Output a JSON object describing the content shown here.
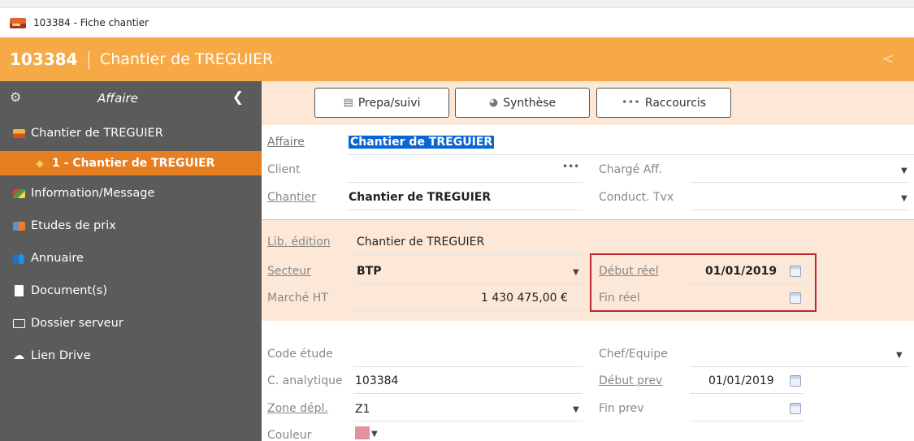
{
  "window": {
    "title": "103384 - Fiche chantier"
  },
  "header": {
    "number": "103384",
    "separator": "|",
    "name": "Chantier de TREGUIER",
    "collapse_glyph": "<"
  },
  "sidebar": {
    "title": "Affaire",
    "items": [
      {
        "label": "Chantier de TREGUIER",
        "icon": "folder-icon"
      },
      {
        "label": "1 - Chantier de TREGUIER",
        "icon": "diamond-icon",
        "active": true
      },
      {
        "label": "Information/Message",
        "icon": "message-icon"
      },
      {
        "label": "Etudes de prix",
        "icon": "price-study-icon"
      },
      {
        "label": "Annuaire",
        "icon": "contacts-icon"
      },
      {
        "label": "Document(s)",
        "icon": "document-icon"
      },
      {
        "label": "Dossier serveur",
        "icon": "server-folder-icon"
      },
      {
        "label": "Lien Drive",
        "icon": "cloud-icon"
      }
    ]
  },
  "toolbar": {
    "prepa_label": "Prepa/suivi",
    "synthese_label": "Synthèse",
    "raccourcis_label": "Raccourcis",
    "raccourcis_glyph": "•••"
  },
  "form": {
    "affaire": {
      "label": "Affaire",
      "value": "Chantier de TREGUIER"
    },
    "client": {
      "label": "Client",
      "value": "",
      "more_glyph": "•••"
    },
    "charge_aff": {
      "label": "Chargé Aff.",
      "value": ""
    },
    "chantier": {
      "label": "Chantier",
      "value": "Chantier de TREGUIER"
    },
    "conduct_tvx": {
      "label": "Conduct. Tvx",
      "value": ""
    },
    "lib_edition": {
      "label": "Lib. édition",
      "value": "Chantier de TREGUIER"
    },
    "secteur": {
      "label": "Secteur",
      "value": "BTP"
    },
    "debut_reel": {
      "label": "Début réel",
      "value": "01/01/2019"
    },
    "marche_ht": {
      "label": "Marché HT",
      "value": "1 430 475,00 €"
    },
    "fin_reel": {
      "label": "Fin réel",
      "value": ""
    },
    "code_etude": {
      "label": "Code étude",
      "value": ""
    },
    "chef_equipe": {
      "label": "Chef/Equipe",
      "value": ""
    },
    "c_analytique": {
      "label": "C. analytique",
      "value": "103384"
    },
    "debut_prev": {
      "label": "Début prev",
      "value": "01/01/2019"
    },
    "zone_depl": {
      "label": "Zone dépl.",
      "value": "Z1"
    },
    "fin_prev": {
      "label": "Fin prev",
      "value": ""
    },
    "couleur": {
      "label": "Couleur",
      "swatch_color": "#e0939a"
    }
  },
  "colors": {
    "accent": "#f6a944",
    "active_item": "#e67e22",
    "sidebar": "#5b5b5b",
    "band": "#fde8d8",
    "highlight_box": "#c0252f"
  }
}
